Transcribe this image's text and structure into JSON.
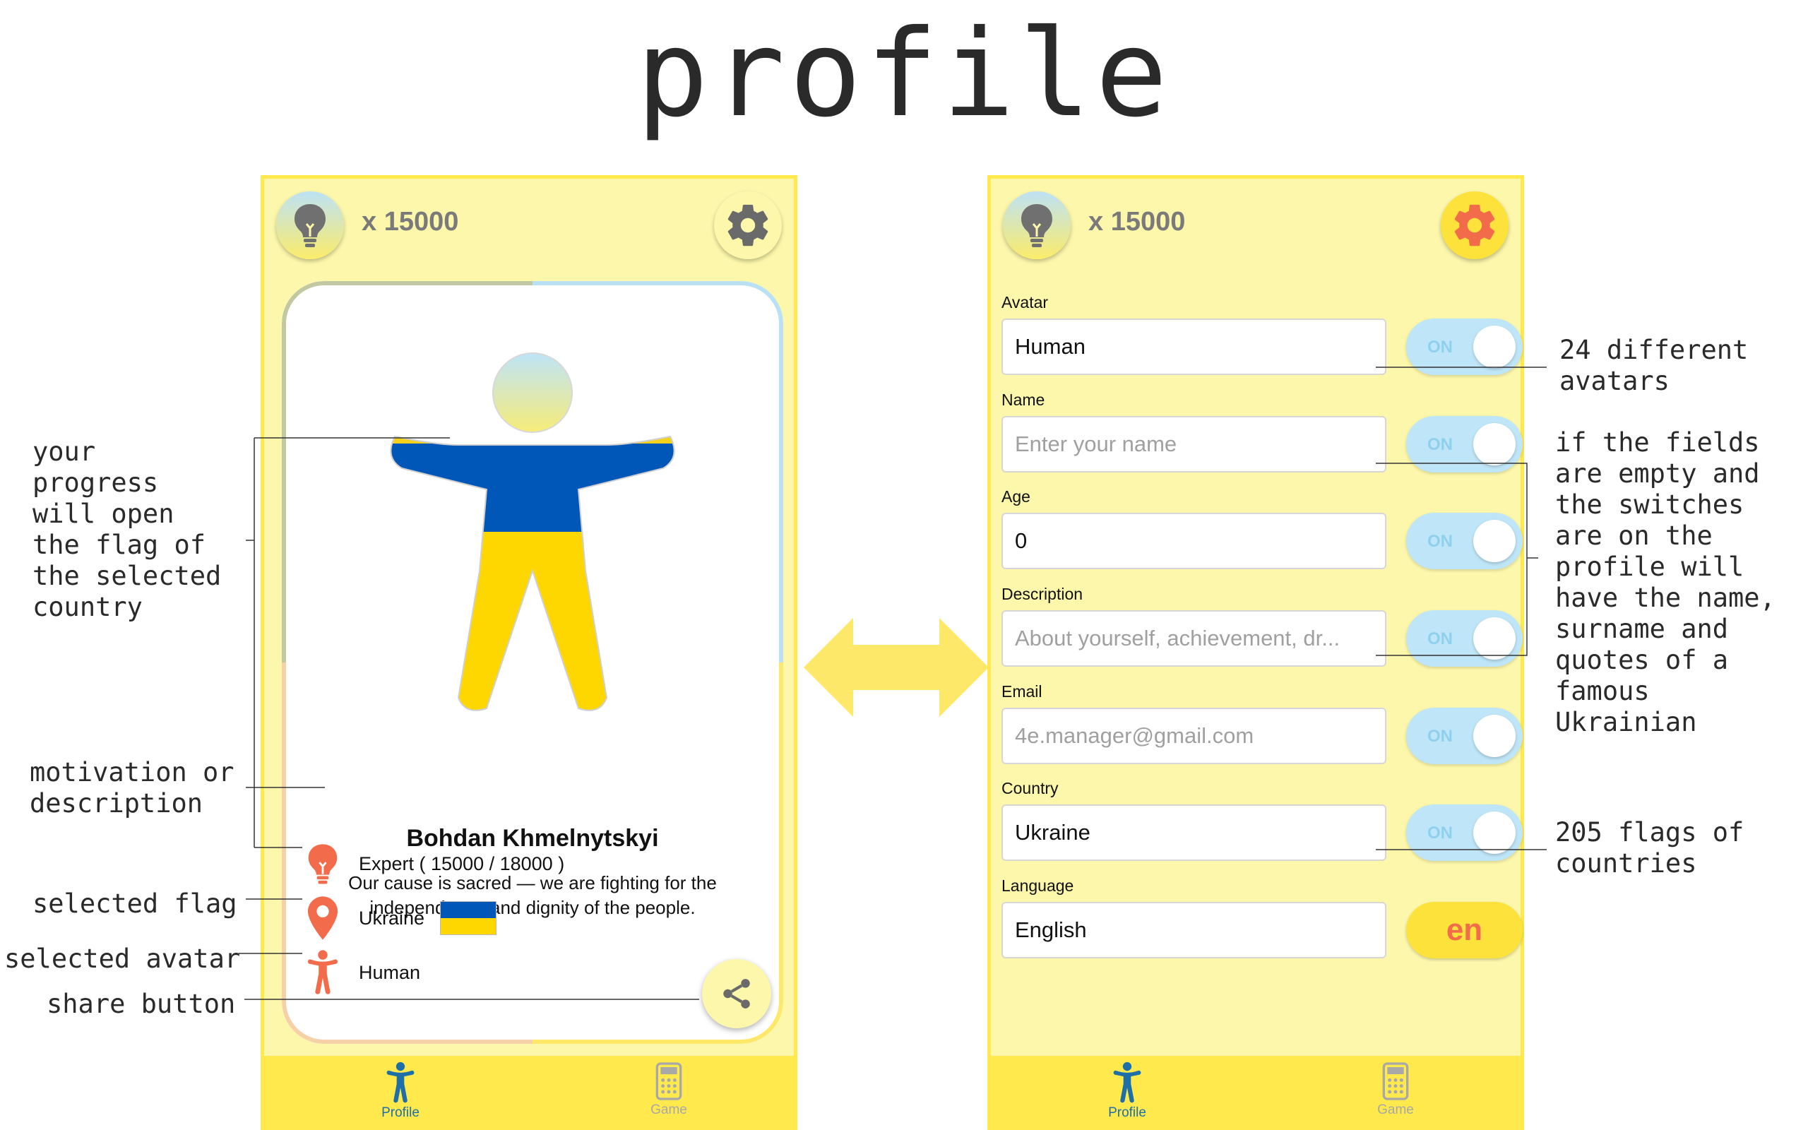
{
  "page_title": "profile",
  "colors": {
    "accent_yellow": "#ffe94d",
    "panel": "#fcf7ab",
    "orange": "#f26b4a",
    "flag_blue": "#0057b7",
    "flag_yellow": "#ffd700",
    "tab_active": "#1e6fa8"
  },
  "hints": {
    "count": "x 15000"
  },
  "profile_card": {
    "name": "Bohdan Khmelnytskyi",
    "description": "Our cause is sacred — we are fighting for the independence and dignity of the people.",
    "progress": "Expert ( 15000 / 18000 )",
    "progress_value": 15000,
    "progress_max": 18000,
    "country": "Ukraine",
    "avatar": "Human"
  },
  "form": {
    "avatar": {
      "label": "Avatar",
      "value": "Human",
      "placeholder": ""
    },
    "name": {
      "label": "Name",
      "value": "",
      "placeholder": "Enter your name"
    },
    "age": {
      "label": "Age",
      "value": "0",
      "placeholder": ""
    },
    "description": {
      "label": "Description",
      "value": "",
      "placeholder": "About yourself, achievement, dr..."
    },
    "email": {
      "label": "Email",
      "value": "",
      "placeholder": "4e.manager@gmail.com"
    },
    "country": {
      "label": "Country",
      "value": "Ukraine",
      "placeholder": ""
    },
    "language": {
      "label": "Language",
      "value": "English",
      "placeholder": ""
    },
    "toggle_label": "ON",
    "language_code": "en"
  },
  "tabs": [
    {
      "label": "Profile"
    },
    {
      "label": "Game"
    }
  ],
  "annotations": {
    "progress": "your\nprogress\nwill open\nthe flag of\nthe selected\ncountry",
    "motivation": "motivation or\ndescription",
    "selected_flag": "selected flag",
    "selected_avatar": "selected avatar",
    "share_button": "share button",
    "avatars": "24 different\navatars",
    "fields_empty": "if the fields\nare empty and\nthe switches\nare on the\nprofile will\nhave the name,\nsurname and\nquotes of a\nfamous\nUkrainian",
    "flags": "205 flags of\ncountries"
  }
}
